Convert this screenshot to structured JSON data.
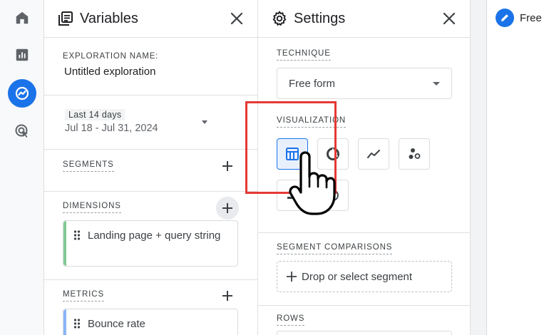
{
  "variables": {
    "title": "Variables",
    "exploration_label": "EXPLORATION NAME:",
    "exploration_name": "Untitled exploration",
    "date_chip": "Last 14 days",
    "date_range": "Jul 18 - Jul 31, 2024",
    "segments_label": "SEGMENTS",
    "dimensions_label": "DIMENSIONS",
    "dimension_items": [
      "Landing page + query string"
    ],
    "metrics_label": "METRICS",
    "metric_items": [
      "Bounce rate"
    ]
  },
  "settings": {
    "title": "Settings",
    "technique_label": "TECHNIQUE",
    "technique_value": "Free form",
    "visualization_label": "VISUALIZATION",
    "segment_comparisons_label": "SEGMENT COMPARISONS",
    "drop_segment_text": "Drop or select segment",
    "rows_label": "ROWS"
  },
  "canvas": {
    "tab_label": "Free"
  },
  "colors": {
    "accent": "#1a73e8",
    "highlight": "#e53935",
    "dimension_bar": "#81c995",
    "metric_bar": "#8ab4f8"
  },
  "icons": [
    "home-icon",
    "reports-icon",
    "explore-icon",
    "advertising-icon",
    "variables-icon",
    "settings-gear-icon",
    "close-icon",
    "plus-icon",
    "drag-handle-icon",
    "table-icon",
    "donut-chart-icon",
    "line-chart-icon",
    "scatter-icon",
    "geo-map-icon",
    "pencil-icon",
    "pointer-hand-icon"
  ]
}
